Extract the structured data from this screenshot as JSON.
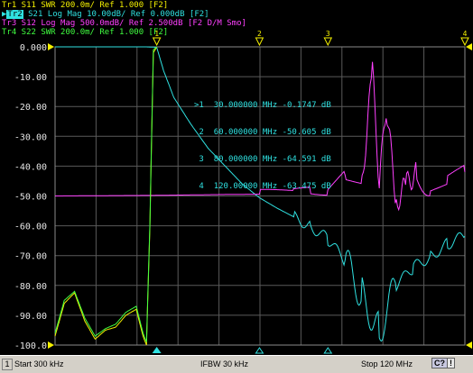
{
  "trace_headers": [
    {
      "id": "Tr1",
      "text": "Tr1 S11 SWR 200.0m/ Ref 1.000 [F2]"
    },
    {
      "id": "Tr2",
      "badge": "Tr2",
      "text": " S21 Log Mag 10.00dB/ Ref 0.000dB [F2]"
    },
    {
      "id": "Tr3",
      "text": "Tr3 S12 Log Mag 500.0mdB/ Ref 2.500dB [F2 D/M Smo]"
    },
    {
      "id": "Tr4",
      "text": "Tr4 S22 SWR 200.0m/ Ref 1.000 [F2]"
    }
  ],
  "colors": {
    "tr1": "#f4f000",
    "tr2": "#2fe0e0",
    "tr3": "#ff40ff",
    "tr4": "#40ff40",
    "grid": "#5a5a5a",
    "plot_border": "#8a8a8a",
    "axis_text": "#e6e6e6"
  },
  "markers": {
    "active_prefix": ">",
    "rows": [
      {
        "n": "1",
        "freq": "30.000000 MHz",
        "value": "-0.1747 dB"
      },
      {
        "n": "2",
        "freq": "60.000000 MHz",
        "value": "-50.605 dB"
      },
      {
        "n": "3",
        "freq": "80.000000 MHz",
        "value": "-64.591 dB"
      },
      {
        "n": "4",
        "freq": "120.00000 MHz",
        "value": "-63.475 dB"
      }
    ]
  },
  "status": {
    "channel": "1",
    "start": "Start 300 kHz",
    "ifbw": "IFBW 30 kHz",
    "stop": "Stop 120 MHz",
    "c_btn": "C?",
    "q_btn": "!"
  },
  "chart_data": {
    "type": "line",
    "x_range": [
      0.3,
      120
    ],
    "ylim": [
      -100,
      0
    ],
    "y_ticks": [
      "0.000",
      "-10.00",
      "-20.00",
      "-30.00",
      "-40.00",
      "-50.00",
      "-60.00",
      "-70.00",
      "-80.00",
      "-90.00",
      "-100.0"
    ],
    "grid": true,
    "series": [
      {
        "name": "Tr2 S21",
        "color": "#2fe0e0",
        "x": [
          0.3,
          20,
          27,
          29,
          30,
          32,
          35,
          40,
          45,
          50,
          55,
          60,
          65,
          70,
          75,
          80,
          85,
          90,
          95,
          100,
          105,
          110,
          115,
          120
        ],
        "y": [
          0,
          0,
          0,
          -0.1,
          -0.17,
          -8,
          -17,
          -26,
          -34,
          -40,
          -46,
          -50.6,
          -54,
          -57,
          -60,
          -64.6,
          -72,
          -83,
          -95,
          -80,
          -74,
          -70,
          -66,
          -63.5
        ]
      },
      {
        "name": "Tr3 S12",
        "color": "#ff40ff",
        "x": [
          0.3,
          30,
          50,
          60,
          70,
          75,
          80,
          85,
          90,
          93,
          95,
          97,
          100,
          103,
          106,
          110,
          115,
          120
        ],
        "y": [
          -50,
          -49.8,
          -49.5,
          -49.4,
          -49,
          -48,
          -49,
          -42,
          -45,
          -8,
          -46,
          -20,
          -52,
          -46,
          -42,
          -48,
          -44,
          -42
        ]
      },
      {
        "name": "Tr1 S11",
        "color": "#f4f000",
        "x": [
          0.3,
          3,
          6,
          9,
          12,
          15,
          18,
          21,
          24,
          26,
          27,
          28,
          29,
          30
        ],
        "y": [
          -97,
          -86,
          -82.5,
          -92,
          -98,
          -95,
          -94,
          -90,
          -88,
          -97,
          -100,
          -60,
          -2,
          0
        ]
      },
      {
        "name": "Tr4 S22",
        "color": "#40ff40",
        "x": [
          0.3,
          3,
          6,
          9,
          12,
          15,
          18,
          21,
          24,
          26,
          27,
          28,
          29,
          30
        ],
        "y": [
          -96,
          -85,
          -82,
          -91,
          -97,
          -94.5,
          -93,
          -89,
          -87,
          -96,
          -99,
          -59,
          -1,
          0
        ]
      }
    ]
  }
}
